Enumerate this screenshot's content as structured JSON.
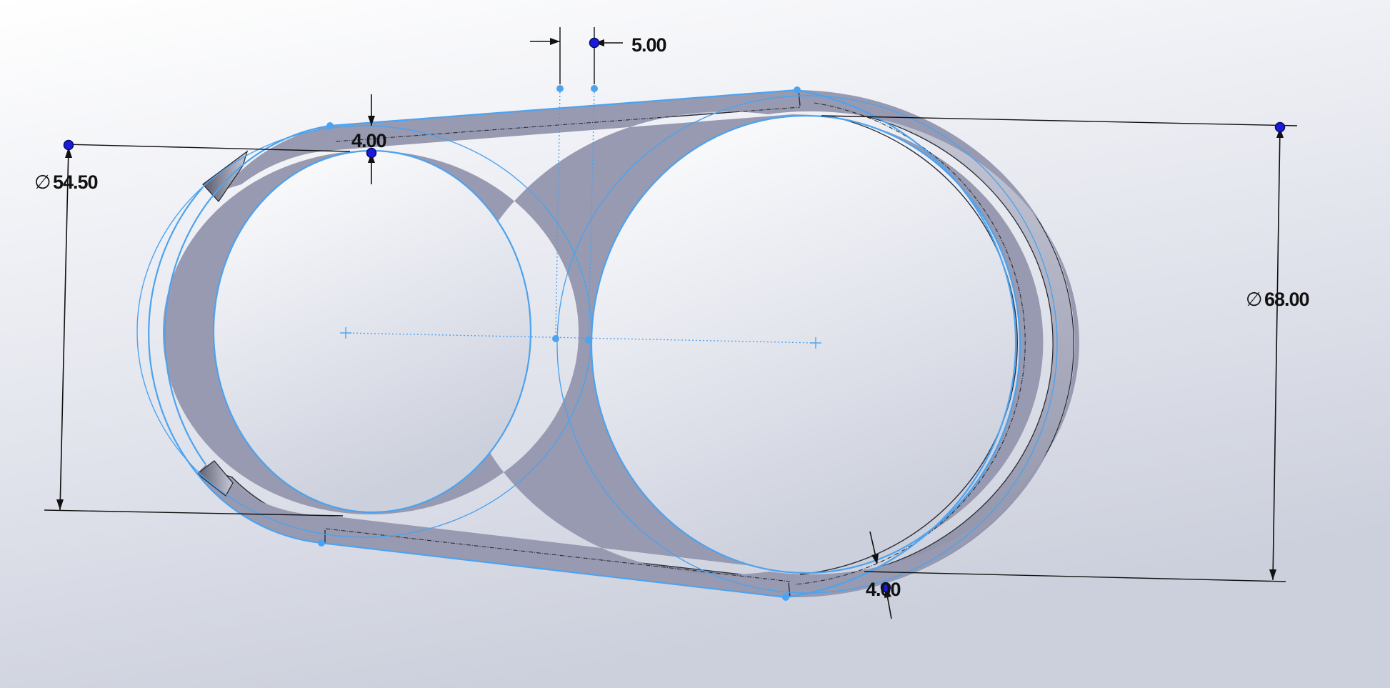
{
  "viewport": {
    "background_top": "#ffffff",
    "background_bottom": "#c9ccd8"
  },
  "colors": {
    "part_face": "#979ab0",
    "part_side": "#b9bccb",
    "sketch": "#4da3ef",
    "dimension": "#111111",
    "handle": "#1a1ad8"
  },
  "dimensions": {
    "spacing": {
      "value": "5.00"
    },
    "top_thickness": {
      "value": "4.00"
    },
    "bottom_thickness": {
      "value": "4.00"
    },
    "small_diameter": {
      "symbol": "∅",
      "value": "54.50"
    },
    "large_diameter": {
      "symbol": "∅",
      "value": "68.00"
    }
  }
}
